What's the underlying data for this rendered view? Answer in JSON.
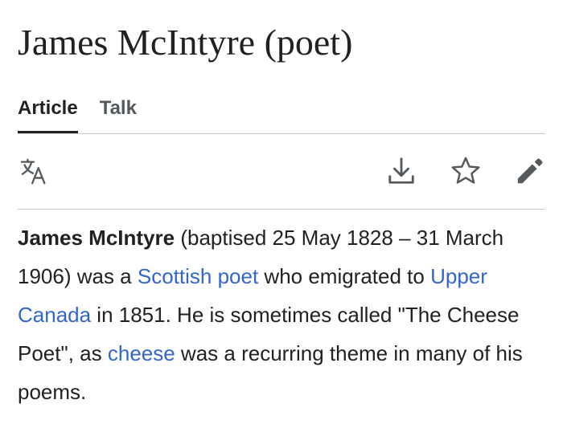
{
  "article": {
    "title": "James McIntyre (poet)"
  },
  "tabs": [
    {
      "label": "Article",
      "selected": true
    },
    {
      "label": "Talk",
      "selected": false
    }
  ],
  "toolbar": {
    "icons": [
      "language-icon",
      "download-icon",
      "star-icon",
      "edit-icon"
    ]
  },
  "body": {
    "subject": "James McIntyre",
    "text1": " (baptised 25 May 1828 – 31 March 1906) was a ",
    "link1": "Scottish poet",
    "text2": " who emigrated to ",
    "link2": "Upper Canada",
    "text3": " in 1851. He is sometimes called \"The Cheese Poet\", as ",
    "link3": "cheese",
    "text4": " was a recurring theme in many of his poems."
  },
  "colors": {
    "link": "#3366cc",
    "text": "#202122",
    "muted": "#54595d",
    "divider": "#c8ccd1"
  }
}
